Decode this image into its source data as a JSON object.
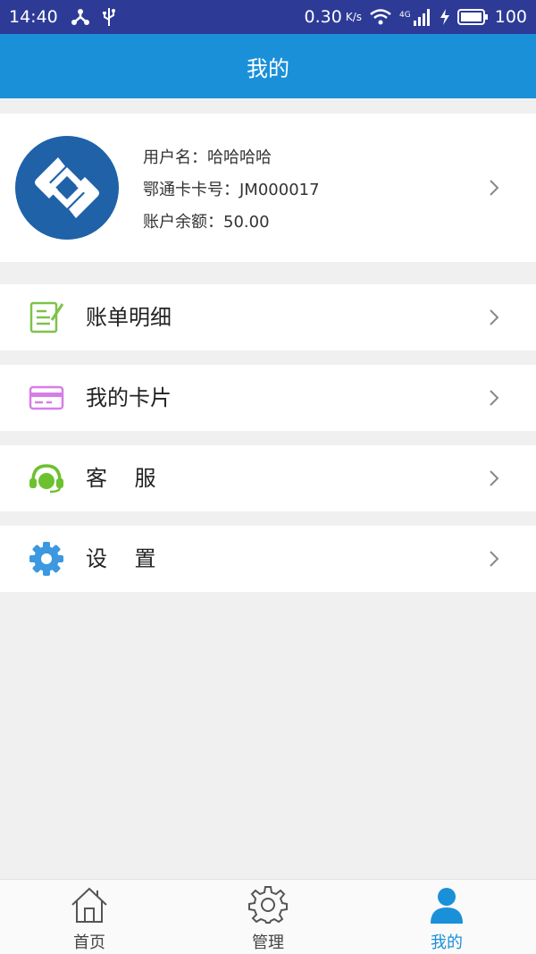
{
  "status_bar": {
    "time": "14:40",
    "net_speed": "0.30",
    "net_unit": "K/s",
    "network_type": "4G",
    "battery": "100"
  },
  "header": {
    "title": "我的"
  },
  "profile": {
    "username_label": "用户名：",
    "username": "哈哈哈哈",
    "card_label": "鄂通卡卡号：",
    "card_number": "JM000017",
    "balance_label": "账户余额：",
    "balance": "50.00"
  },
  "menu": [
    {
      "label": "账单明细",
      "icon": "bill-detail-icon"
    },
    {
      "label": "我的卡片",
      "icon": "card-icon"
    },
    {
      "label": "客    服",
      "icon": "customer-service-icon"
    },
    {
      "label": "设    置",
      "icon": "settings-icon"
    }
  ],
  "tabs": [
    {
      "label": "首页",
      "icon": "home-icon",
      "active": false
    },
    {
      "label": "管理",
      "icon": "gear-icon",
      "active": false
    },
    {
      "label": "我的",
      "icon": "user-icon",
      "active": true
    }
  ],
  "colors": {
    "status_bar": "#2d3b97",
    "header": "#1a90d9",
    "active_tab": "#1a90d9",
    "bill_icon": "#7dc34a",
    "card_icon": "#d77ee6",
    "service_icon": "#6cc12f",
    "settings_icon": "#3c98e0"
  }
}
